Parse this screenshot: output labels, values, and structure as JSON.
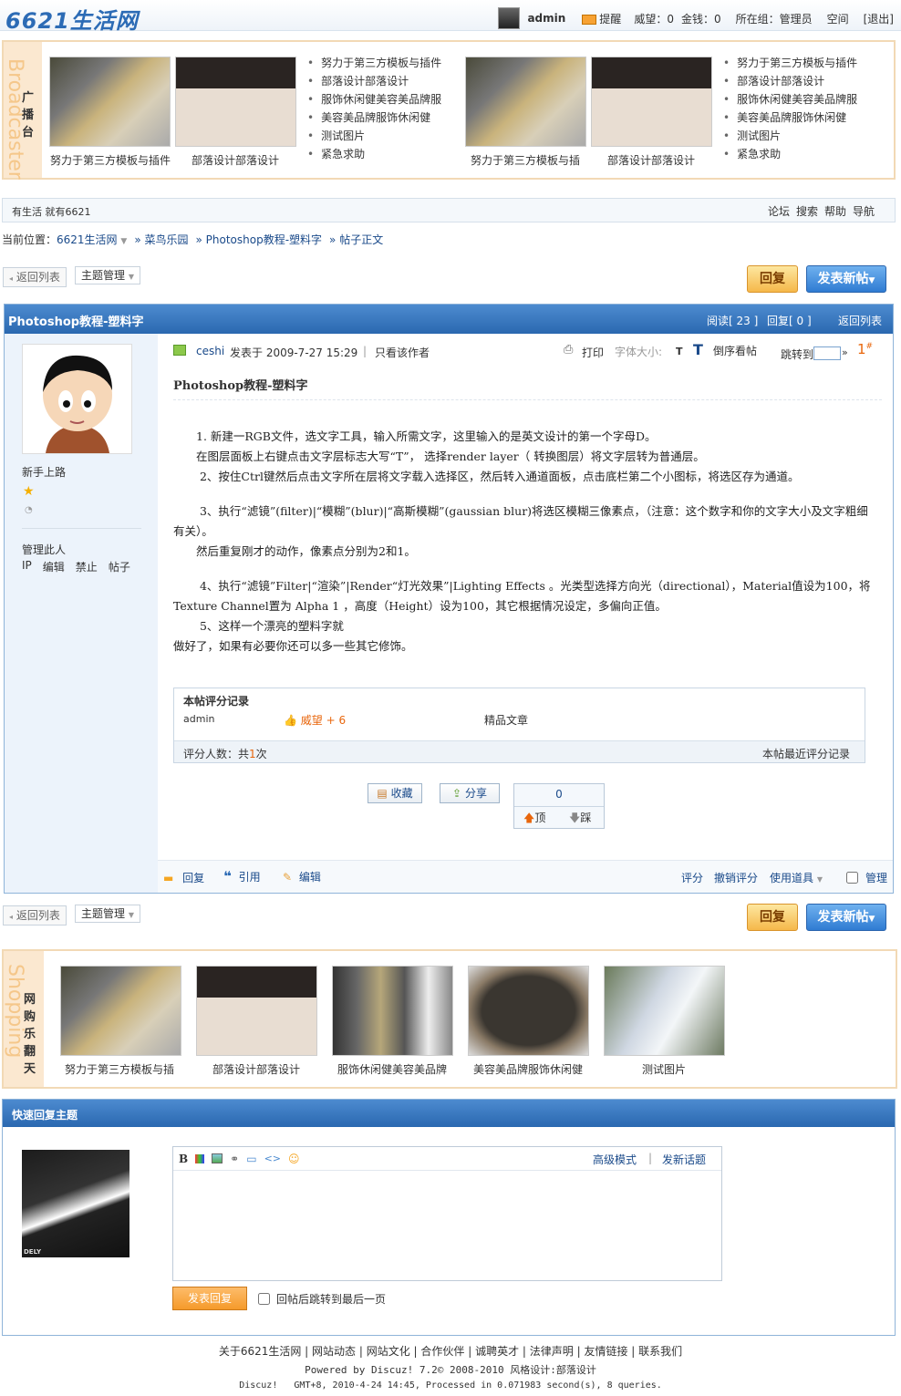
{
  "header": {
    "logo": "6621生活网",
    "username": "admin",
    "remind": "提醒",
    "prestige": "威望：0",
    "money": "金钱：0",
    "group": "所在组：管理员",
    "space": "空间",
    "logout": "[退出]"
  },
  "broadcaster": {
    "side_letter": "Broadcaster",
    "side_title": "广播台",
    "captions": [
      "努力于第三方模板与插件",
      "部落设计部落设计",
      "努力于第三方模板与插",
      "部落设计部落设计"
    ],
    "list_left": [
      "努力于第三方模板与插件",
      "部落设计部落设计",
      "服饰休闲健美容美品牌服",
      "美容美品牌服饰休闲健",
      "测试图片",
      "紧急求助"
    ],
    "list_right": [
      "努力于第三方模板与插件",
      "部落设计部落设计",
      "服饰休闲健美容美品牌服",
      "美容美品牌服饰休闲健",
      "测试图片",
      "紧急求助"
    ]
  },
  "slogan": {
    "text": "有生活 就有6621",
    "links": [
      "论坛",
      "搜索",
      "帮助",
      "导航"
    ]
  },
  "breadcrumb": {
    "prefix": "当前位置：",
    "items": [
      "6621生活网",
      "» 菜鸟乐园",
      "» Photoshop教程-塑料字",
      "» 帖子正文"
    ]
  },
  "toolbar": {
    "back": "返回列表",
    "manage": "主题管理",
    "reply": "回复",
    "newpost": "发表新帖"
  },
  "post": {
    "title": "Photoshop教程-塑料字",
    "read": "阅读[ 23 ]",
    "replies": "回复[ 0 ]",
    "back": "返回列表",
    "user_title": "新手上路",
    "manage_user": "管理此人",
    "user_links": [
      "IP",
      "编辑",
      "禁止",
      "帖子"
    ],
    "author": "ceshi",
    "posted": "发表于 2009-7-27 15:29",
    "only_author": "只看该作者",
    "print": "打印",
    "font_size": "字体大小:",
    "font_t1": "T",
    "font_t2": "T",
    "reverse": "倒序看帖",
    "jump": "跳转到",
    "jump_sym": "»",
    "floor": "1",
    "subject": "Photoshop教程-塑料字",
    "paragraphs": [
      "　　1. 新建一RGB文件，选文字工具，输入所需文字，这里输入的是英文设计的第一个字母D。",
      "　　在图层面板上右键点击文字层标志大写“T”， 选择render layer（ 转换图层）将文字层转为普通层。",
      "　　 2、按住Ctrl键然后点击文字所在层将文字载入选择区，然后转入通道面板，点击底栏第二个小图标，将选区存为通道。",
      "",
      "　　 3、执行“滤镜”(filter)|“模糊”(blur)|“高斯模糊”(gaussian blur)将选区模糊三像素点，（注意：这个数字和你的文字大小及文字粗细有关）。",
      "　　然后重复刚才的动作，像素点分别为2和1。",
      "",
      "　　 4、执行“滤镜”Filter|“渲染”|Render“灯光效果”|Lighting Effects 。光类型选择方向光（directional），Material值设为100，将Texture Channel置为 Alpha 1 ，高度（Height）设为100，其它根据情况设定，多偏向正值。",
      "　　 5、这样一个漂亮的塑料字就",
      "做好了，如果有必要你还可以多一些其它修饰。"
    ],
    "rating_title": "本帖评分记录",
    "rating_user": "admin",
    "rating_score": "威望 + 6",
    "rating_note": "精品文章",
    "rating_count_label": "评分人数：共",
    "rating_count": "1",
    "rating_count_suffix": "次",
    "rating_recent": "本帖最近评分记录",
    "fav": "收藏",
    "share": "分享",
    "vote_count": "0",
    "up": "顶",
    "down": "踩",
    "foot_reply": "回复",
    "foot_quote": "引用",
    "foot_edit": "编辑",
    "foot_rate": "评分",
    "foot_unrate": "撤销评分",
    "foot_tools": "使用道具",
    "foot_manage": "管理"
  },
  "shopping": {
    "side_letter": "Shopping",
    "side_title": "网购乐翻天",
    "captions": [
      "努力于第三方模板与插",
      "部落设计部落设计",
      "服饰休闲健美容美品牌",
      "美容美品牌服饰休闲健",
      "测试图片"
    ]
  },
  "quick_reply": {
    "title": "快速回复主题",
    "advanced": "高级模式",
    "new_topic": "发新话题",
    "submit": "发表回复",
    "goto_last": "回帖后跳转到最后一页",
    "avatar_label": "DELY"
  },
  "footer": {
    "links": [
      "关于6621生活网",
      "网站动态",
      "网站文化",
      "合作伙伴",
      "诚聘英才",
      "法律声明",
      "友情链接",
      "联系我们"
    ],
    "powered": "Powered by Discuz! 7.2© 2008-2010 风格设计:部落设计",
    "stats": "Discuz!   GMT+8, 2010-4-24 14:45, Processed in 0.071983 second(s), 8 queries."
  }
}
